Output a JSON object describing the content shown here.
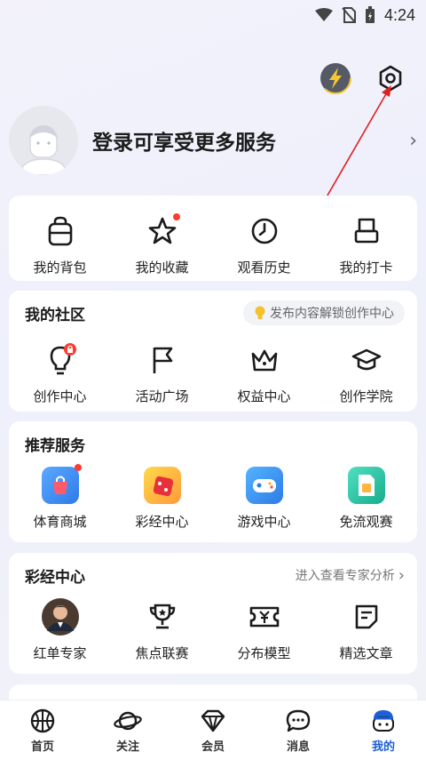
{
  "status_bar": {
    "time": "4:24"
  },
  "profile": {
    "login_prompt": "登录可享受更多服务"
  },
  "quick_links": [
    {
      "label": "我的背包",
      "icon": "backpack-icon"
    },
    {
      "label": "我的收藏",
      "icon": "star-icon"
    },
    {
      "label": "观看历史",
      "icon": "clock-icon"
    },
    {
      "label": "我的打卡",
      "icon": "checkin-icon"
    }
  ],
  "community": {
    "title": "我的社区",
    "hint": "发布内容解锁创作中心",
    "items": [
      {
        "label": "创作中心",
        "icon": "lightbulb-lock-icon"
      },
      {
        "label": "活动广场",
        "icon": "flag-icon"
      },
      {
        "label": "权益中心",
        "icon": "crown-icon"
      },
      {
        "label": "创作学院",
        "icon": "graduation-cap-icon"
      }
    ]
  },
  "recommended": {
    "title": "推荐服务",
    "items": [
      {
        "label": "体育商城",
        "icon": "shopping-bag-icon",
        "color": "#3d8ff5"
      },
      {
        "label": "彩经中心",
        "icon": "lottery-dice-icon",
        "color": "#f24b4b"
      },
      {
        "label": "游戏中心",
        "icon": "gamepad-icon",
        "color": "#2f8cf0"
      },
      {
        "label": "免流观赛",
        "icon": "sim-card-icon",
        "color": "#29c4a6"
      }
    ]
  },
  "lottery": {
    "title": "彩经中心",
    "link": "进入查看专家分析",
    "items": [
      {
        "label": "红单专家",
        "icon": "expert-avatar"
      },
      {
        "label": "焦点联赛",
        "icon": "trophy-icon"
      },
      {
        "label": "分布模型",
        "icon": "ticket-icon"
      },
      {
        "label": "精选文章",
        "icon": "article-icon"
      }
    ]
  },
  "tabbar": [
    {
      "label": "首页",
      "icon": "basketball-icon"
    },
    {
      "label": "关注",
      "icon": "planet-icon"
    },
    {
      "label": "会员",
      "icon": "diamond-icon"
    },
    {
      "label": "消息",
      "icon": "chat-bubble-icon"
    },
    {
      "label": "我的",
      "icon": "profile-face-icon",
      "active": true
    }
  ],
  "colors": {
    "accent": "#1e5fd6",
    "badge": "#ff3b30",
    "page_bg": "#f1f2f8"
  }
}
